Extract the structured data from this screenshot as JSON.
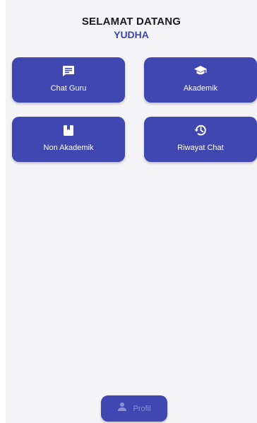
{
  "header": {
    "title": "SELAMAT DATANG",
    "user_name": "YUDHA"
  },
  "menu": [
    {
      "label": "Chat Guru",
      "icon": "chat-message-icon"
    },
    {
      "label": "Akademik",
      "icon": "graduation-cap-icon"
    },
    {
      "label": "Non Akademik",
      "icon": "bookmark-icon"
    },
    {
      "label": "Riwayat Chat",
      "icon": "history-icon"
    }
  ],
  "bottom_nav": {
    "profile_label": "Profil",
    "icon": "person-icon"
  },
  "colors": {
    "card": "#4047b0",
    "accent_text": "#3d46ad",
    "background": "#f4f4f6"
  }
}
